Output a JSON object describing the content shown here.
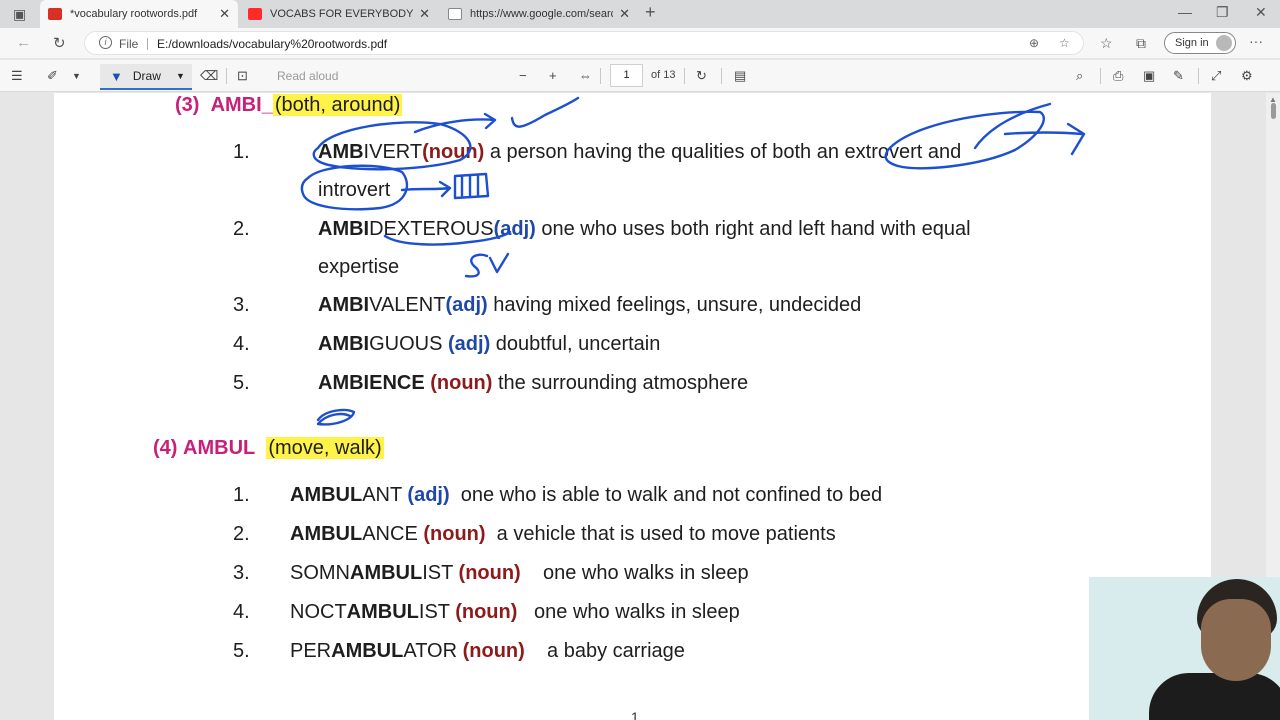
{
  "browser": {
    "tabs": [
      {
        "title": "*vocabulary rootwords.pdf",
        "icon": "pdf-icon",
        "active": true
      },
      {
        "title": "VOCABS FOR EVERYBODY | STOR",
        "icon": "youtube-icon",
        "active": false
      },
      {
        "title": "https://www.google.com/search",
        "icon": "page-icon",
        "active": false
      }
    ],
    "new_tab_label": "+",
    "address": {
      "scheme_label": "File",
      "url": "E:/downloads/vocabulary%20rootwords.pdf"
    },
    "signin_label": "Sign in",
    "more_label": "···"
  },
  "pdf_toolbar": {
    "draw_label": "Draw",
    "read_aloud_label": "Read aloud",
    "zoom_out": "−",
    "zoom_in": "+",
    "page_number": "1",
    "page_count": "of 13"
  },
  "document": {
    "section3": {
      "number": "(3)",
      "root": "AMBI",
      "meaning": "(both, around)",
      "entries": [
        {
          "n": "1.",
          "bold": "AMB",
          "rest": "IVERT",
          "pos": "(noun)",
          "pos_type": "noun",
          "def": " a person having the qualities of both an extrovert and",
          "def2": "introvert"
        },
        {
          "n": "2.",
          "bold": "AMBI",
          "rest": "DEXTEROUS",
          "pos": "(adj)",
          "pos_type": "adj",
          "def": " one who uses both right and left hand with equal",
          "def2": "expertise"
        },
        {
          "n": "3.",
          "bold": "AMBI",
          "rest": "VALENT",
          "pos": "(adj)",
          "pos_type": "adj",
          "def": " having mixed feelings, unsure, undecided"
        },
        {
          "n": "4.",
          "bold": "AMBI",
          "rest": "GUOUS ",
          "pos": "(adj)",
          "pos_type": "adj",
          "def": " doubtful, uncertain"
        },
        {
          "n": "5.",
          "bold": "AMBIENCE ",
          "rest": "",
          "pos": "(noun)",
          "pos_type": "noun",
          "def": " the surrounding atmosphere"
        }
      ]
    },
    "section4": {
      "number": "(4)",
      "root": "AMBUL",
      "meaning": "(move, walk)",
      "entries": [
        {
          "n": "1.",
          "pre": "",
          "bold": "AMBUL",
          "rest": "ANT ",
          "pos": "(adj)",
          "pos_type": "adj",
          "def": "  one who is able to walk and not confined to bed"
        },
        {
          "n": "2.",
          "pre": "",
          "bold": "AMBUL",
          "rest": "ANCE ",
          "pos": "(noun)",
          "pos_type": "noun",
          "def": "  a vehicle that is used to move patients"
        },
        {
          "n": "3.",
          "pre": "SOMN",
          "bold": "AMBUL",
          "rest": "IST ",
          "pos": "(noun)",
          "pos_type": "noun",
          "def": "    one who walks in sleep"
        },
        {
          "n": "4.",
          "pre": "NOCT",
          "bold": "AMBUL",
          "rest": "IST ",
          "pos": "(noun)",
          "pos_type": "noun",
          "def": "   one who walks in sleep"
        },
        {
          "n": "5.",
          "pre": "PER",
          "bold": "AMBUL",
          "rest": "ATOR ",
          "pos": "(noun)",
          "pos_type": "noun",
          "def": "    a baby carriage"
        }
      ]
    },
    "page_footer": "1"
  },
  "colors": {
    "heading": "#c8207a",
    "highlight": "#fff34a",
    "adj": "#1f47a8",
    "noun": "#8e1b1b",
    "ink": "#1d4fd1"
  }
}
